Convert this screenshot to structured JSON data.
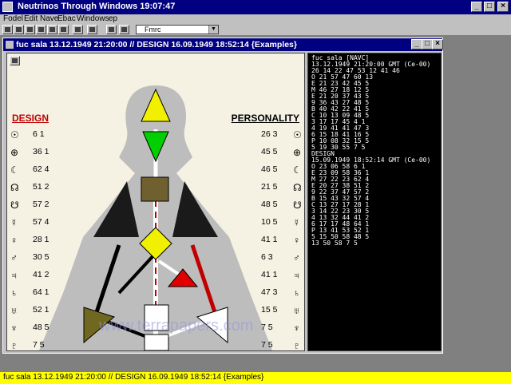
{
  "app": {
    "title": "Neutrinos Through Windows 19:07:47"
  },
  "menu": [
    "Fodel",
    "Edit",
    "Nave",
    "Ebac",
    "Windows",
    "ep"
  ],
  "toolbar": {
    "combo_value": "Fmrc"
  },
  "chart_window": {
    "title": "fuc sala 13.12.1949 21:20:00 // DESIGN 16.09.1949 18:52:14 {Examples}",
    "design_label": "DESIGN",
    "personality_label": "PERSONALITY",
    "design_gates": [
      "6 1",
      "36 1",
      "62 4",
      "51 2",
      "57 2",
      "57 4",
      "28 1",
      "30 5",
      "41 2",
      "64 1",
      "52 1",
      "48 5",
      "7 5"
    ],
    "personality_gates": [
      "26 3",
      "45 5",
      "46 5",
      "21 5",
      "48 5",
      "10 5",
      "41 1",
      "6 3",
      "41 1",
      "47 3",
      "15 5",
      "7 5",
      "7 5"
    ],
    "watermark": "www.terrapapers.com"
  },
  "text_panel": {
    "lines": [
      "fuc sala                   [NAVC]",
      "13.12.1949 21:20:00 GMT (Ce-00)",
      "26 14 22 47  53 12 41 46",
      "O  21 57 47  60 13",
      "E  21 23 42  45 5",
      "M  46 27 18  12 5",
      "E  21 20 37  43 5",
      "9  36 43 27  48 5",
      "B  40 42 22  41 5",
      "C  10 13 09  48 5",
      "3  17 17 45  4 1",
      "4  19 41 41  47 3",
      "6  15 18 41  16 5",
      "P  10 08 32  15 5",
      "5  19 30 55  7 5",
      "DESIGN",
      "15.09.1949 18:52:14 GMT (Ce-00)",
      "O  23 06 58  6 1",
      "E  23 09 58  36 1",
      "M  27 22 23  62 4",
      "E  20 27 38  51 2",
      "9  22 37 47  57 2",
      "B  15 43 32  57 4",
      "C  13 27 17  28 1",
      "3  14 22 23  30 5",
      "4  13 32 44  41 2",
      "6  17 17 48  64 1",
      "P  13 41 53  52 1",
      "5  15 50 58  48 5",
      "   13 50 58  7 5"
    ]
  },
  "status": {
    "text": "fuc sala 13.12.1949 21:20:00 // DESIGN 16.09.1949 18:52:14 {Examples}"
  },
  "colors": {
    "title_blue": "#000080",
    "chart_bg": "#f5f2e4",
    "status_yellow": "#ffff00",
    "design_red": "#c00000"
  }
}
